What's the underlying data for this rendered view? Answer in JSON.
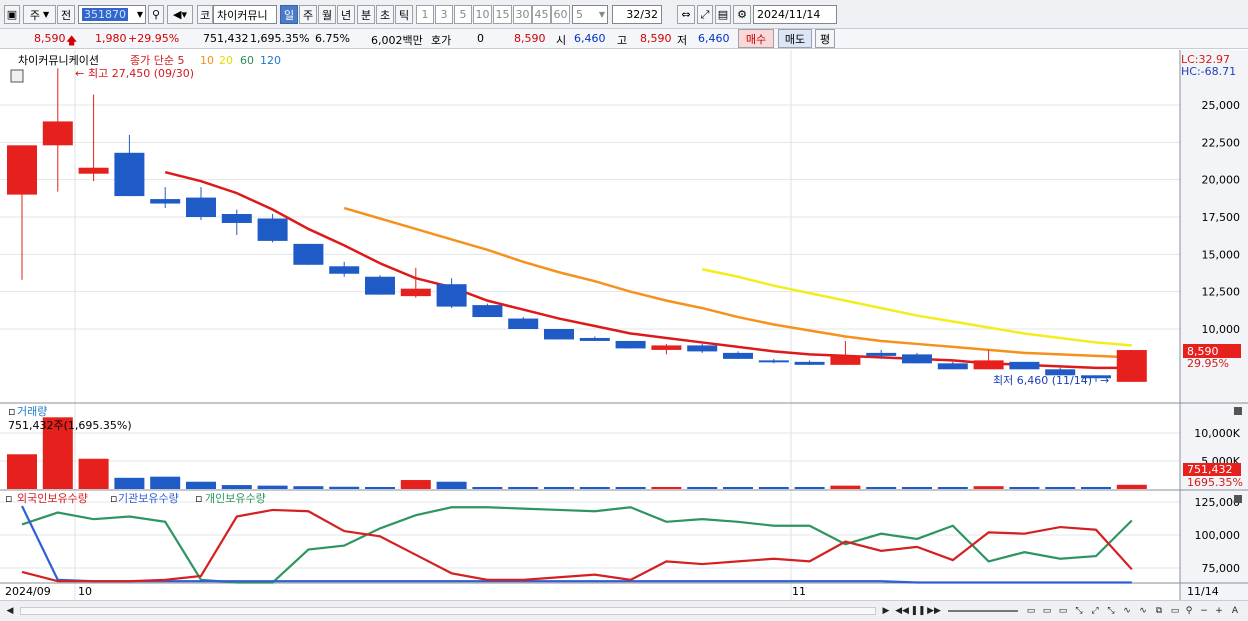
{
  "toolbar": {
    "period": "주",
    "prev": "전",
    "code": "351870",
    "stock_name": "차이커뮤니",
    "intervals": [
      "일",
      "주",
      "월",
      "년",
      "분",
      "초",
      "틱"
    ],
    "active_interval": "일",
    "minute_options": [
      "1",
      "3",
      "5",
      "10",
      "15",
      "30",
      "45",
      "60"
    ],
    "step": "5",
    "count": "32",
    "count_total": "/32",
    "date": "2024/11/14"
  },
  "quote": {
    "price": "8,590",
    "change": "1,980",
    "change_pct": "+29.95%",
    "volume": "751,432",
    "vol_ratio": "1,695.35%",
    "turnover": "6.75%",
    "amount": "6,002백만",
    "hoga_label": "호가",
    "hoga": "0",
    "hoga_price": "8,590",
    "open_label": "시",
    "open": "6,460",
    "high_label": "고",
    "high": "8,590",
    "low_label": "저",
    "low": "6,460",
    "buy_label": "매수",
    "sell_label": "매도",
    "eval_label": "평"
  },
  "price_panel": {
    "name": "차이커뮤니케이션",
    "ma_title": "종가 단순 5",
    "ma_periods": [
      "10",
      "20",
      "60",
      "120"
    ],
    "high_note": "최고 27,450 (09/30)",
    "low_note": "최저 6,460 (11/14)",
    "lc": "LC:32.97",
    "hc": "HC:-68.71",
    "last_price": "8,590",
    "last_pct": "29.95%"
  },
  "volume_panel": {
    "title": "거래량",
    "current": "751,432주(1,695.35%)",
    "last_vol": "751,432",
    "last_pct": "1695.35%"
  },
  "holdings_panel": {
    "titles": [
      "외국인보유수량",
      "기관보유수량",
      "개인보유수량"
    ]
  },
  "x_axis": {
    "labels": [
      "2024/09",
      "10",
      "11",
      "11/14"
    ]
  },
  "colors": {
    "up": "#e6201c",
    "down": "#1f5bc6",
    "ma5": "#dd1a1a",
    "ma10": "#f5921e",
    "ma20": "#f2ee1e",
    "foreign": "#d42020",
    "inst": "#2f5fd4",
    "indiv": "#2e9460",
    "grid": "#c8ccd4"
  },
  "chart_data": {
    "type": "candlestick",
    "price_axis": {
      "min": 5000,
      "max": 27500,
      "ticks": [
        "25,000",
        "22,500",
        "20,000",
        "17,500",
        "15,000",
        "12,500",
        "10,000"
      ]
    },
    "volume_axis": {
      "max": 13000,
      "ticks": [
        "10,000K",
        "5,000K"
      ]
    },
    "holdings_axis": {
      "min": 60000,
      "max": 130000,
      "ticks": [
        "125,000",
        "100,000",
        "75,000"
      ]
    },
    "candles": [
      {
        "o": 19000,
        "h": 22300,
        "l": 13300,
        "c": 22300
      },
      {
        "o": 22300,
        "h": 27450,
        "l": 19200,
        "c": 23900
      },
      {
        "o": 20400,
        "h": 25700,
        "l": 19900,
        "c": 20800
      },
      {
        "o": 21800,
        "h": 23000,
        "l": 18900,
        "c": 18900
      },
      {
        "o": 18700,
        "h": 19500,
        "l": 18100,
        "c": 18400
      },
      {
        "o": 18800,
        "h": 19500,
        "l": 17300,
        "c": 17500
      },
      {
        "o": 17700,
        "h": 18000,
        "l": 16300,
        "c": 17100
      },
      {
        "o": 17400,
        "h": 17700,
        "l": 15800,
        "c": 15900
      },
      {
        "o": 15700,
        "h": 15700,
        "l": 14300,
        "c": 14300
      },
      {
        "o": 14200,
        "h": 14500,
        "l": 13500,
        "c": 13700
      },
      {
        "o": 13500,
        "h": 13600,
        "l": 12300,
        "c": 12300
      },
      {
        "o": 12200,
        "h": 14100,
        "l": 12100,
        "c": 12700
      },
      {
        "o": 13000,
        "h": 13400,
        "l": 11400,
        "c": 11500
      },
      {
        "o": 11600,
        "h": 11700,
        "l": 10800,
        "c": 10800
      },
      {
        "o": 10700,
        "h": 10800,
        "l": 10000,
        "c": 10000
      },
      {
        "o": 10000,
        "h": 10000,
        "l": 9300,
        "c": 9300
      },
      {
        "o": 9400,
        "h": 9500,
        "l": 9200,
        "c": 9200
      },
      {
        "o": 9200,
        "h": 9200,
        "l": 8700,
        "c": 8700
      },
      {
        "o": 8600,
        "h": 9000,
        "l": 8300,
        "c": 8900
      },
      {
        "o": 8900,
        "h": 9000,
        "l": 8400,
        "c": 8500
      },
      {
        "o": 8400,
        "h": 8500,
        "l": 8000,
        "c": 8000
      },
      {
        "o": 7900,
        "h": 8000,
        "l": 7700,
        "c": 7800
      },
      {
        "o": 7800,
        "h": 7900,
        "l": 7600,
        "c": 7600
      },
      {
        "o": 7600,
        "h": 9200,
        "l": 7600,
        "c": 8200
      },
      {
        "o": 8400,
        "h": 8600,
        "l": 8000,
        "c": 8200
      },
      {
        "o": 8300,
        "h": 8400,
        "l": 7700,
        "c": 7700
      },
      {
        "o": 7700,
        "h": 7800,
        "l": 7300,
        "c": 7300
      },
      {
        "o": 7300,
        "h": 8600,
        "l": 7300,
        "c": 7900
      },
      {
        "o": 7800,
        "h": 7800,
        "l": 7300,
        "c": 7300
      },
      {
        "o": 7300,
        "h": 7400,
        "l": 6900,
        "c": 6900
      },
      {
        "o": 6900,
        "h": 6900,
        "l": 6460,
        "c": 6700
      },
      {
        "o": 6460,
        "h": 8590,
        "l": 6460,
        "c": 8590
      }
    ],
    "ma5": [
      null,
      null,
      null,
      null,
      20500,
      19900,
      19100,
      18000,
      16700,
      15600,
      14400,
      13400,
      12800,
      11900,
      11300,
      10700,
      10200,
      9700,
      9400,
      9100,
      8800,
      8500,
      8300,
      8200,
      8100,
      8000,
      7900,
      7700,
      7600,
      7500,
      7400,
      7400
    ],
    "ma10": [
      null,
      null,
      null,
      null,
      null,
      null,
      null,
      null,
      null,
      18100,
      17400,
      16700,
      16000,
      15300,
      14500,
      13800,
      13200,
      12500,
      11900,
      11400,
      10800,
      10300,
      9900,
      9500,
      9200,
      9000,
      8800,
      8600,
      8400,
      8300,
      8200,
      8100
    ],
    "ma20": [
      null,
      null,
      null,
      null,
      null,
      null,
      null,
      null,
      null,
      null,
      null,
      null,
      null,
      null,
      null,
      null,
      null,
      null,
      null,
      14000,
      13500,
      12900,
      12400,
      11900,
      11400,
      10900,
      10500,
      10100,
      9700,
      9400,
      9100,
      8900
    ],
    "volume": [
      6200,
      12800,
      5400,
      2000,
      2200,
      1300,
      700,
      600,
      500,
      400,
      300,
      1600,
      1300,
      150,
      150,
      150,
      150,
      150,
      180,
      150,
      150,
      150,
      100,
      600,
      200,
      150,
      150,
      500,
      150,
      150,
      150,
      751
    ],
    "foreign": [
      72000,
      65000,
      65000,
      65000,
      66000,
      69000,
      114000,
      119000,
      118000,
      103000,
      99000,
      85000,
      71000,
      66000,
      66000,
      68000,
      70000,
      66000,
      80000,
      78000,
      80000,
      82000,
      80000,
      95000,
      88000,
      91000,
      81000,
      102000,
      101000,
      106000,
      104000,
      74000
    ],
    "inst": [
      122000,
      66000,
      65000,
      65000,
      65000,
      65000,
      65000,
      65000,
      65000,
      65000,
      65000,
      65000,
      65000,
      65000,
      65000,
      65000,
      65000,
      65000,
      65000,
      65000,
      65000,
      65000,
      65000,
      65000,
      65000,
      64000,
      64000,
      64000,
      64000,
      64000,
      64000,
      64000
    ],
    "indiv": [
      108000,
      117000,
      112000,
      114000,
      110000,
      66000,
      64000,
      64000,
      89000,
      92000,
      105000,
      115000,
      121000,
      121000,
      120000,
      119000,
      118000,
      121000,
      110000,
      112000,
      110000,
      107000,
      107000,
      93000,
      101000,
      97000,
      107000,
      80000,
      87000,
      82000,
      84000,
      111000
    ]
  }
}
